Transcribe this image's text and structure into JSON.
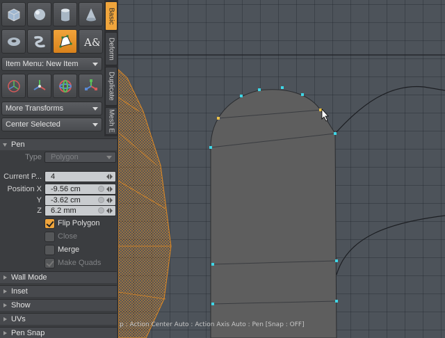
{
  "toolbar": {
    "row1": [
      "cube-icon",
      "sphere-icon",
      "cylinder-icon",
      "cone-icon"
    ],
    "row2": [
      "torus-icon",
      "tube-icon",
      "pen-icon",
      "text-icon"
    ],
    "row3": [
      "transform-icon",
      "move-icon",
      "rotate-icon",
      "scale-icon"
    ],
    "text_tool_label": "A&",
    "active_tool": "pen-icon"
  },
  "item_menu": {
    "label": "Item Menu: New Item"
  },
  "more_transforms": {
    "label": "More Transforms"
  },
  "center_selected": {
    "label": "Center Selected"
  },
  "tabs": [
    "Basic",
    "Deform",
    "Duplicate",
    "Mesh E"
  ],
  "pen": {
    "section_title": "Pen",
    "type_label": "Type",
    "type_value": "Polygon",
    "current_point_label": "Current P...",
    "current_point_value": "4",
    "position_label": "Position X",
    "y_label": "Y",
    "z_label": "Z",
    "x_value": "-9.56 cm",
    "y_value": "-3.62 cm",
    "z_value": "6.2 mm",
    "flip_polygon": "Flip Polygon",
    "close": "Close",
    "merge": "Merge",
    "make_quads": "Make Quads"
  },
  "sections": [
    "Wall Mode",
    "Inset",
    "Show",
    "UVs",
    "Pen Snap"
  ],
  "viewport": {
    "status": "p : Action Center Auto : Action Axis Auto : Pen  [Snap : OFF]"
  },
  "colors": {
    "accent": "#f0a53c",
    "vertex": "#3fd6e6",
    "mesh_fill": "#5e5e5e"
  }
}
